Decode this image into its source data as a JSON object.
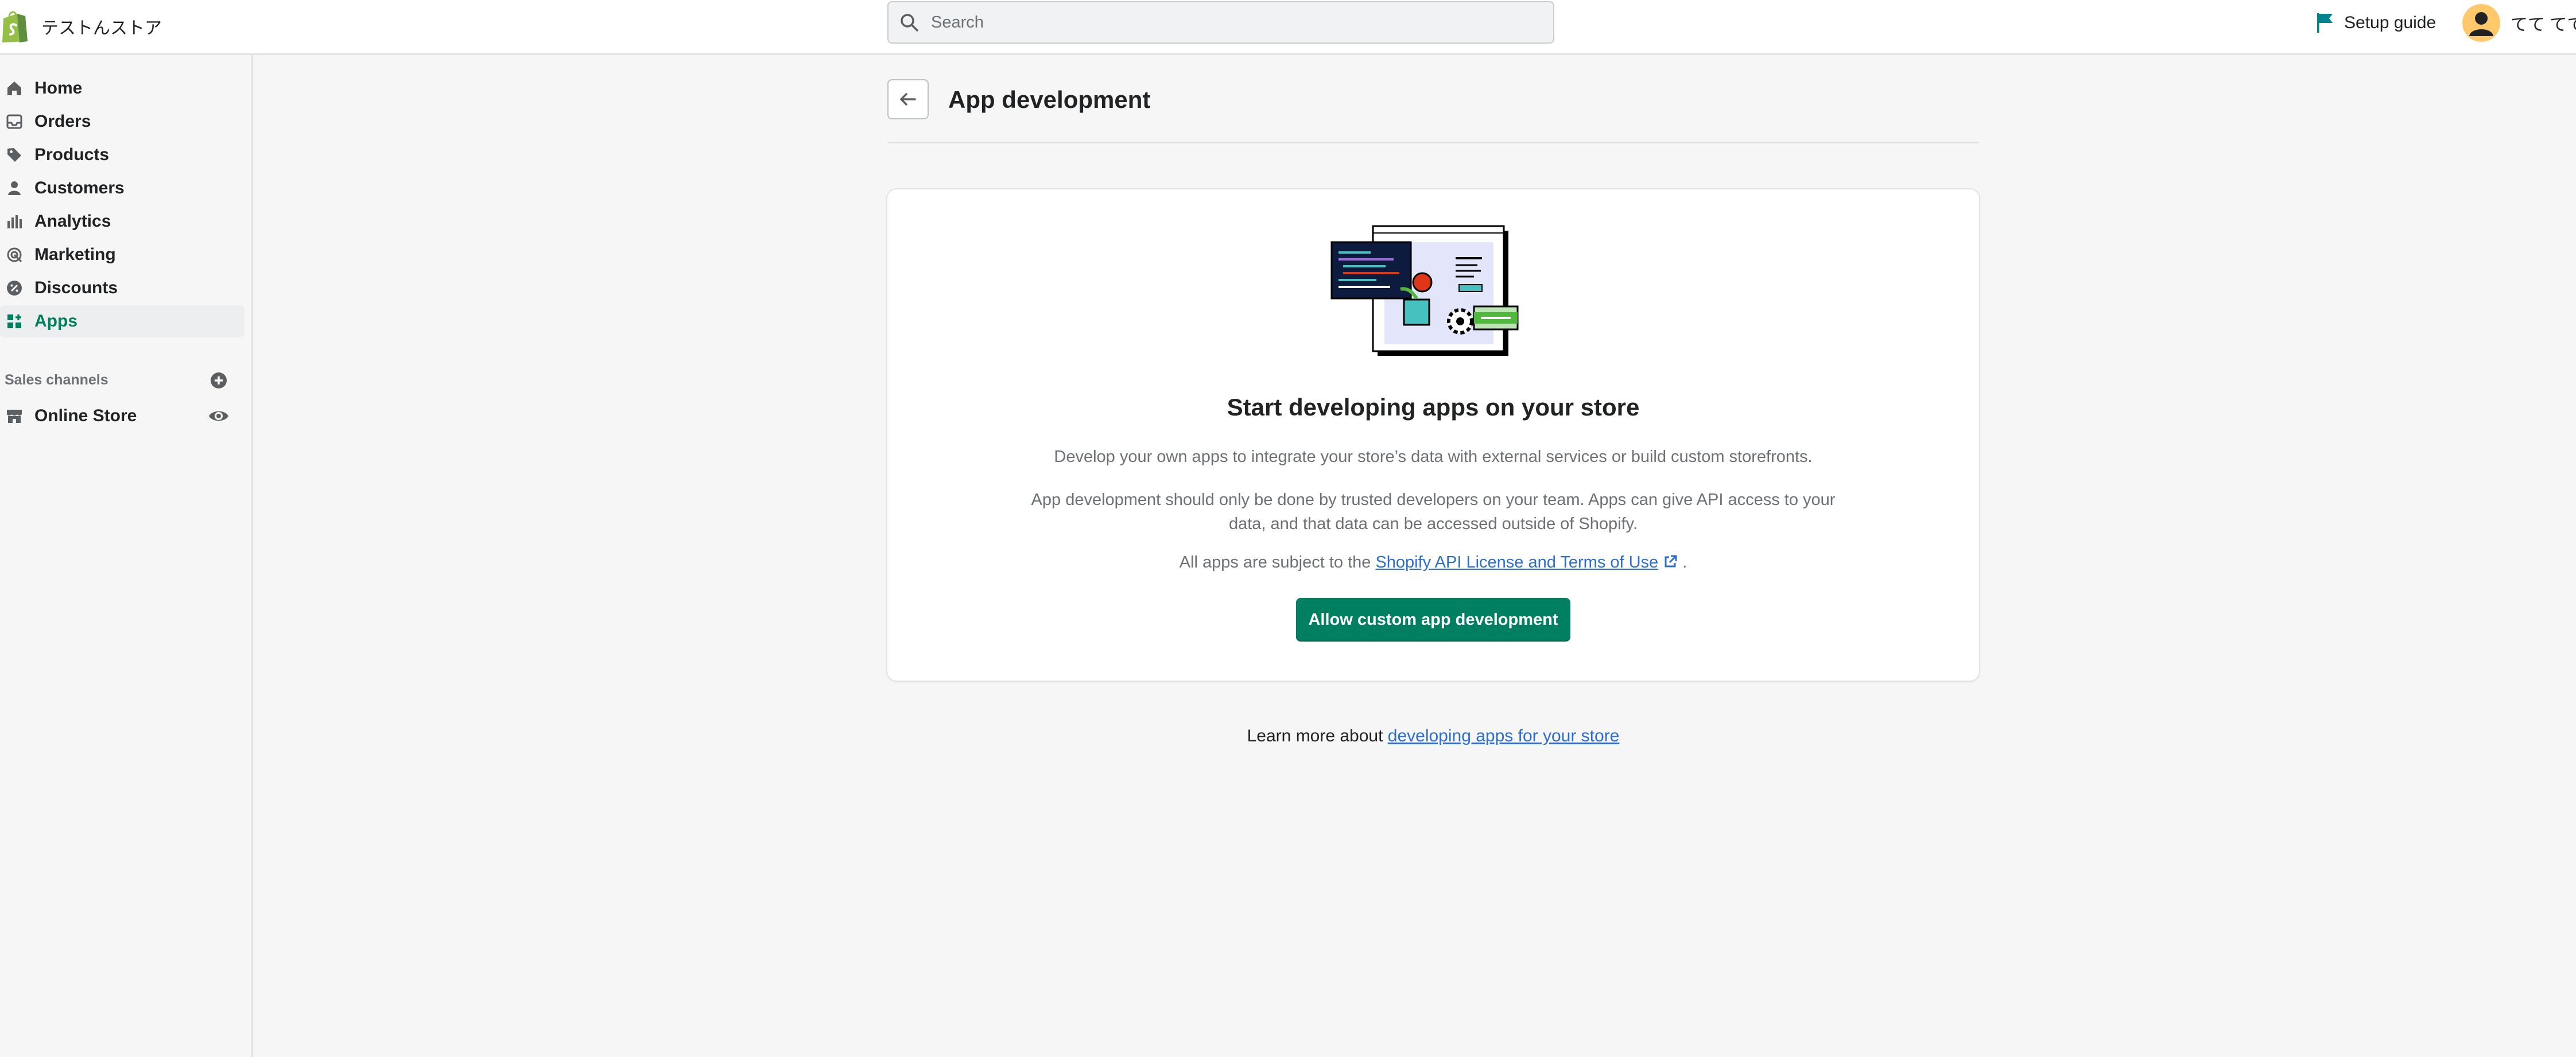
{
  "topbar": {
    "store_name": "テストんストア",
    "search_placeholder": "Search",
    "setup_guide_label": "Setup guide",
    "user_name": "てて てて"
  },
  "sidebar": {
    "items": [
      {
        "label": "Home",
        "icon": "home-icon"
      },
      {
        "label": "Orders",
        "icon": "inbox-icon"
      },
      {
        "label": "Products",
        "icon": "tag-icon"
      },
      {
        "label": "Customers",
        "icon": "person-icon"
      },
      {
        "label": "Analytics",
        "icon": "bar-chart-icon"
      },
      {
        "label": "Marketing",
        "icon": "target-icon"
      },
      {
        "label": "Discounts",
        "icon": "discount-icon"
      },
      {
        "label": "Apps",
        "icon": "apps-icon",
        "active": true
      }
    ],
    "sales_channels_title": "Sales channels",
    "channels": [
      {
        "label": "Online Store",
        "icon": "store-icon"
      }
    ]
  },
  "page": {
    "title": "App development"
  },
  "card": {
    "title": "Start developing apps on your store",
    "paragraph1": "Develop your own apps to integrate your store’s data with external services or build custom storefronts.",
    "paragraph2": "App development should only be done by trusted developers on your team. Apps can give API access to your data, and that data can be accessed outside of Shopify.",
    "paragraph3_prefix": "All apps are subject to the ",
    "paragraph3_link": "Shopify API License and Terms of Use",
    "paragraph3_suffix": " .",
    "button_label": "Allow custom app development"
  },
  "footer": {
    "learn_prefix": "Learn more about ",
    "learn_link": "developing apps for your store"
  },
  "colors": {
    "accent": "#008060",
    "active_nav": "#007f5f",
    "link": "#2c6ecb",
    "avatar": "#ffc96b",
    "flag": "#00848e"
  }
}
